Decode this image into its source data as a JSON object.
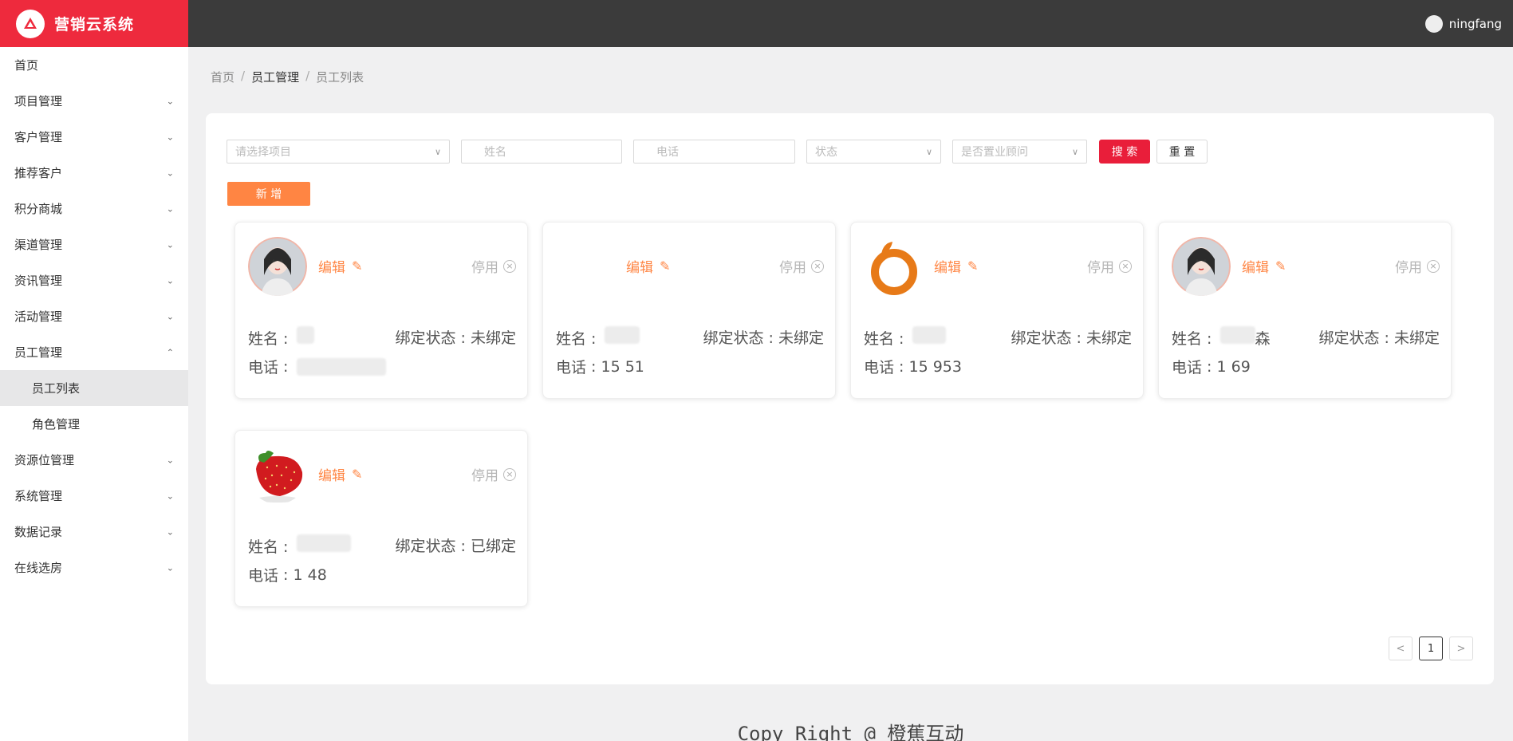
{
  "app": {
    "title": "营销云系统"
  },
  "user": {
    "name": "ningfang"
  },
  "sidebar": {
    "items": [
      {
        "label": "首页",
        "chevron": ""
      },
      {
        "label": "项目管理",
        "chevron": "⌄"
      },
      {
        "label": "客户管理",
        "chevron": "⌄"
      },
      {
        "label": "推荐客户",
        "chevron": "⌄"
      },
      {
        "label": "积分商城",
        "chevron": "⌄"
      },
      {
        "label": "渠道管理",
        "chevron": "⌄"
      },
      {
        "label": "资讯管理",
        "chevron": "⌄"
      },
      {
        "label": "活动管理",
        "chevron": "⌄"
      },
      {
        "label": "员工管理",
        "chevron": "⌃"
      },
      {
        "label": "员工列表",
        "chevron": ""
      },
      {
        "label": "角色管理",
        "chevron": ""
      },
      {
        "label": "资源位管理",
        "chevron": "⌄"
      },
      {
        "label": "系统管理",
        "chevron": "⌄"
      },
      {
        "label": "数据记录",
        "chevron": "⌄"
      },
      {
        "label": "在线选房",
        "chevron": "⌄"
      }
    ]
  },
  "breadcrumb": {
    "home": "首页",
    "section": "员工管理",
    "page": "员工列表",
    "sep": "/"
  },
  "filters": {
    "project_placeholder": "请选择项目",
    "name_placeholder": "姓名",
    "phone_placeholder": "电话",
    "status_placeholder": "状态",
    "consultant_placeholder": "是否置业顾问",
    "search_label": "搜 索",
    "reset_label": "重 置",
    "add_label": "新 增"
  },
  "card_labels": {
    "edit": "编辑",
    "disable": "停用",
    "name": "姓名",
    "phone": "电话"
  },
  "employees": [
    {
      "avatar": "girl-photo",
      "name_visible": "",
      "phone_visible": "",
      "bind_status": "绑定状态 : 未绑定"
    },
    {
      "avatar": "none",
      "name_visible": "",
      "phone_visible": "15    51",
      "bind_status": "绑定状态 : 未绑定"
    },
    {
      "avatar": "orange-logo",
      "name_visible": "",
      "phone_visible": "15    953",
      "bind_status": "绑定状态 : 未绑定"
    },
    {
      "avatar": "girl-photo",
      "name_visible": "森",
      "phone_visible": "1    69",
      "bind_status": "绑定状态 : 未绑定"
    },
    {
      "avatar": "strawberry-photo",
      "name_visible": "",
      "phone_visible": "1    48",
      "bind_status": "绑定状态 : 已绑定"
    }
  ],
  "pagination": {
    "prev": "<",
    "current": "1",
    "next": ">"
  },
  "footer": {
    "text": "Copy Right @ 橙蕉互动"
  },
  "colors": {
    "brand_red": "#ee2a3d",
    "accent_orange": "#ff8543",
    "topbar": "#3b3b3b"
  }
}
